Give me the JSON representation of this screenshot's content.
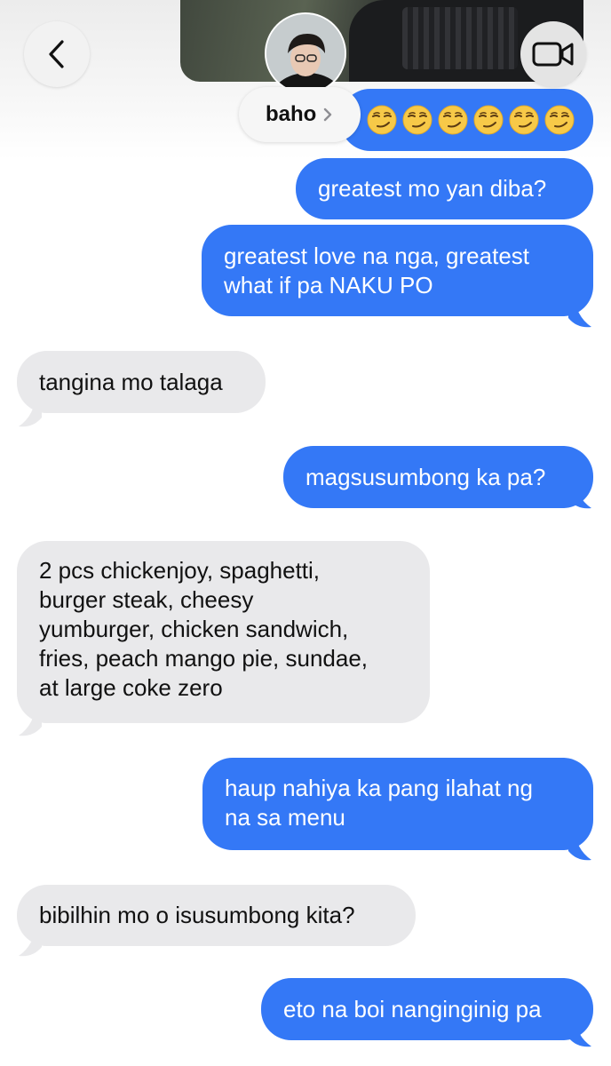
{
  "header": {
    "contact_name": "baho"
  },
  "messages": [
    {
      "side": "outgoing",
      "text": "😏😏😏😏😏😏",
      "emoji_count": 6
    },
    {
      "side": "outgoing",
      "text": "greatest mo yan diba?"
    },
    {
      "side": "outgoing",
      "lines": [
        "greatest love na nga, greatest",
        "what if pa NAKU PO"
      ]
    },
    {
      "side": "incoming",
      "text": "tangina mo talaga"
    },
    {
      "side": "outgoing",
      "text": "magsusumbong ka pa?"
    },
    {
      "side": "incoming",
      "lines": [
        "2 pcs chickenjoy, spaghetti,",
        "burger steak, cheesy",
        "yumburger, chicken sandwich,",
        "fries, peach mango pie, sundae,",
        "at large coke zero"
      ]
    },
    {
      "side": "outgoing",
      "lines": [
        "haup nahiya ka pang ilahat ng",
        "na sa menu"
      ]
    },
    {
      "side": "incoming",
      "text": "bibilhin mo o isusumbong kita?"
    },
    {
      "side": "outgoing",
      "text": "eto na boi nanginginig pa"
    }
  ],
  "colors": {
    "outgoing_bubble": "#3478f6",
    "incoming_bubble": "#e9e9eb",
    "outgoing_text": "#ffffff",
    "incoming_text": "#111111"
  },
  "icons": [
    "back-chevron-icon",
    "video-camera-icon",
    "chevron-right-icon",
    "smirk-emoji-icon"
  ]
}
